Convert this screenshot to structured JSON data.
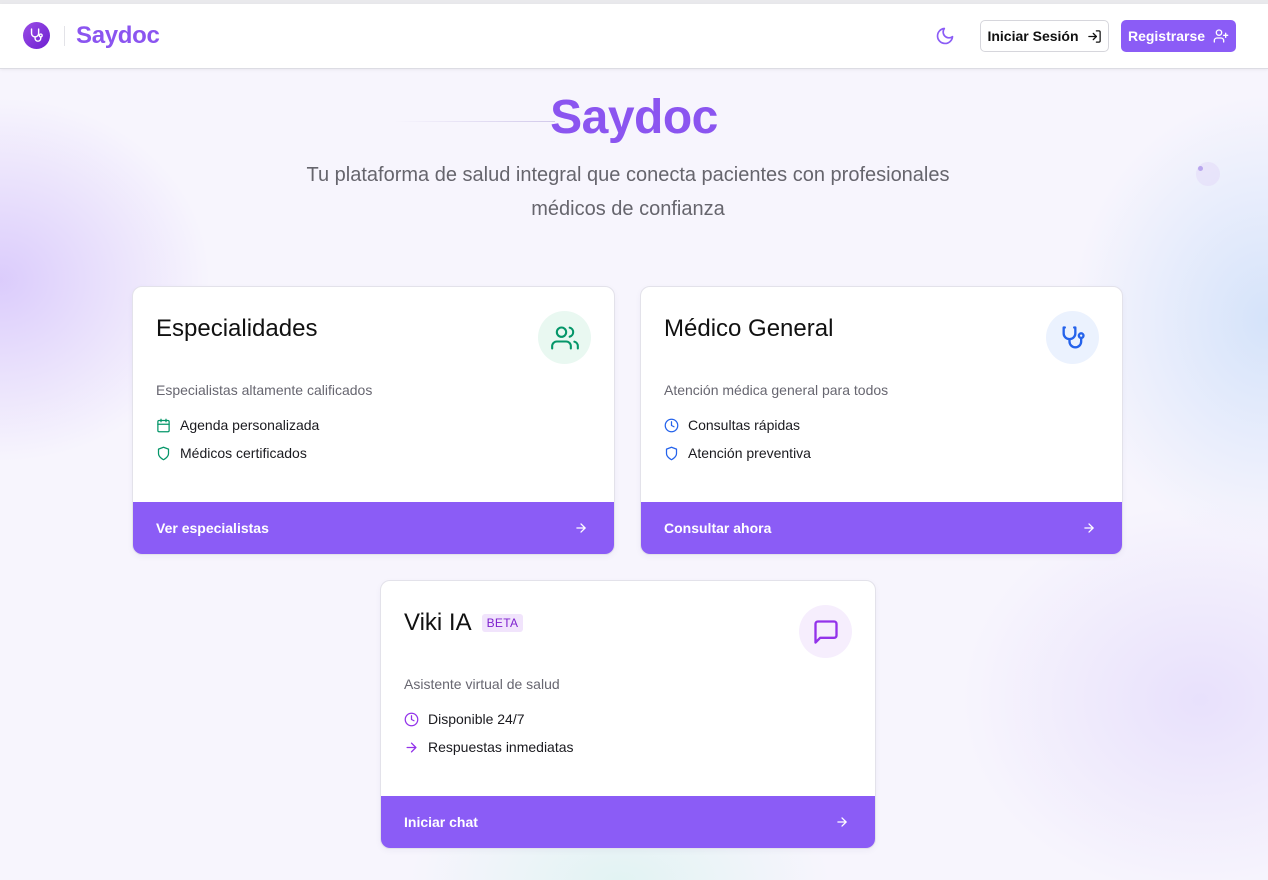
{
  "header": {
    "brand": "Saydoc",
    "login_label": "Iniciar Sesión",
    "register_label": "Registrarse"
  },
  "hero": {
    "title": "Saydoc",
    "subtitle": "Tu plataforma de salud integral que conecta pacientes con profesionales médicos de confianza"
  },
  "cards": [
    {
      "title": "Especialidades",
      "icon": "users-icon",
      "accent": "#059669",
      "description": "Especialistas altamente calificados",
      "features": [
        {
          "icon": "calendar-icon",
          "label": "Agenda personalizada"
        },
        {
          "icon": "shield-icon",
          "label": "Médicos certificados"
        }
      ],
      "cta": "Ver especialistas"
    },
    {
      "title": "Médico General",
      "icon": "stethoscope-icon",
      "accent": "#2563eb",
      "description": "Atención médica general para todos",
      "features": [
        {
          "icon": "clock-icon",
          "label": "Consultas rápidas"
        },
        {
          "icon": "shield-icon",
          "label": "Atención preventiva"
        }
      ],
      "cta": "Consultar ahora"
    },
    {
      "title": "Viki IA",
      "badge": "BETA",
      "icon": "chat-icon",
      "accent": "#9333ea",
      "description": "Asistente virtual de salud",
      "features": [
        {
          "icon": "clock-icon",
          "label": "Disponible 24/7"
        },
        {
          "icon": "arrow-right-icon",
          "label": "Respuestas inmediatas"
        }
      ],
      "cta": "Iniciar chat"
    }
  ],
  "colors": {
    "brand": "#8b55f0",
    "button": "#8b5cf6"
  }
}
